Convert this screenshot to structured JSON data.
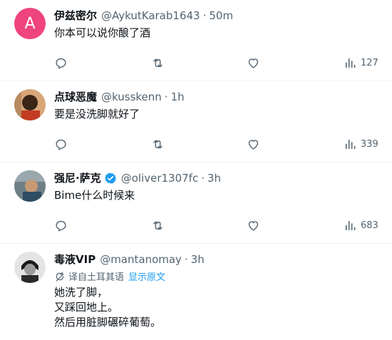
{
  "tweets": [
    {
      "name": "伊兹密尔",
      "handle": "@AykutKarab1643",
      "time": "50m",
      "avatar_letter": "A",
      "text": "你本可以说你酿了酒",
      "views": "127"
    },
    {
      "name": "点球恶魔",
      "handle": "@kusskenn",
      "time": "1h",
      "text": "要是没洗脚就好了",
      "views": "339"
    },
    {
      "name": "强尼·萨克",
      "handle": "@oliver1307fc",
      "time": "3h",
      "text": "Bime什么时候来",
      "views": "683"
    },
    {
      "name": "毒液VIP",
      "handle": "@mantanomay",
      "time": "3h",
      "translated_from": "译自土耳其语",
      "show_original": "显示原文",
      "text": "她洗了脚，\n又踩回地上。\n然后用脏脚碾碎葡萄。"
    }
  ],
  "separator": "·",
  "colors": {
    "accent": "#1d9bf0",
    "avatar_a": "#f0447d",
    "muted": "#536471"
  },
  "icons": [
    "reply-icon",
    "retweet-icon",
    "like-icon",
    "views-icon",
    "verified-badge-icon",
    "translate-icon"
  ]
}
